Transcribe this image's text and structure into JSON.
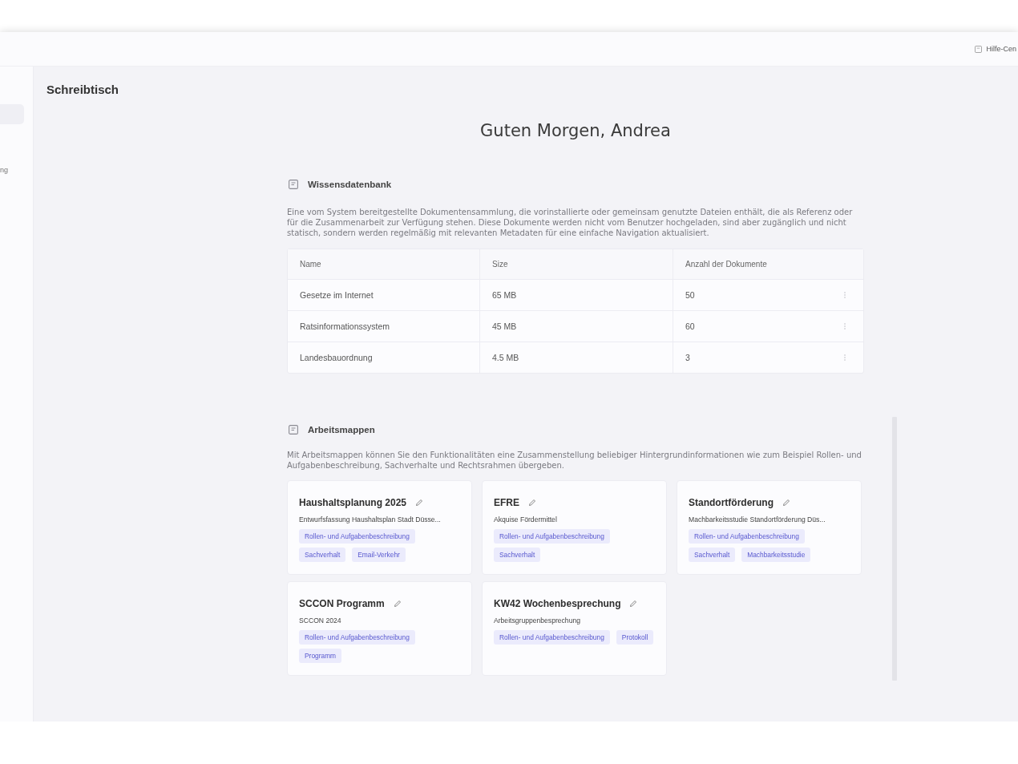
{
  "top_bar": {
    "help_link": "Hilfe-Cen"
  },
  "sidebar": {
    "items": [
      {
        "selected": true
      },
      {
        "label": "ng",
        "selected": false
      }
    ]
  },
  "page_title": "Schreibtisch",
  "greeting": "Guten Morgen, Andrea",
  "knowledge_base": {
    "title": "Wissensdatenbank",
    "description": "Eine vom System bereitgestellte Dokumentensammlung, die vorinstallierte oder gemeinsam genutzte Dateien enthält, die als Referenz oder für die Zusammenarbeit zur Verfügung stehen. Diese Dokumente werden nicht vom Benutzer hochgeladen, sind aber zugänglich und nicht statisch, sondern werden regelmäßig mit relevanten Metadaten für eine einfache Navigation aktualisiert.",
    "table": {
      "columns": [
        "Name",
        "Size",
        "Anzahl der Dokumente"
      ],
      "rows": [
        [
          "Gesetze im Internet",
          "65 MB",
          "50"
        ],
        [
          "Ratsinformationssystem",
          "45 MB",
          "60"
        ],
        [
          "Landesbauordnung",
          "4.5 MB",
          "3"
        ]
      ]
    }
  },
  "workbooks": {
    "title": "Arbeitsmappen",
    "description": "Mit Arbeitsmappen können Sie den Funktionalitäten eine Zusammenstellung beliebiger Hintergrundinformationen wie zum Beispiel Rollen- und Aufgabenbeschreibung, Sachverhalte und Rechtsrahmen übergeben.",
    "cards": [
      {
        "title": "Haushaltsplanung 2025",
        "subtitle": "Entwurfsfassung Haushaltsplan Stadt Düsse...",
        "tags": [
          "Rollen- und Aufgabenbeschreibung",
          "Sachverhalt",
          "Email-Verkehr"
        ]
      },
      {
        "title": "EFRE",
        "subtitle": "Akquise Fördermittel",
        "tags": [
          "Rollen- und Aufgabenbeschreibung",
          "Sachverhalt"
        ]
      },
      {
        "title": "Standortförderung",
        "subtitle": "Machbarkeitsstudie Standortförderung Düs...",
        "tags": [
          "Rollen- und Aufgabenbeschreibung",
          "Sachverhalt",
          "Machbarkeitsstudie"
        ]
      },
      {
        "title": "SCCON Programm",
        "subtitle": "SCCON 2024",
        "tags": [
          "Rollen- und Aufgabenbeschreibung",
          "Programm"
        ]
      },
      {
        "title": "KW42 Wochenbesprechung",
        "subtitle": "Arbeitsgruppenbesprechung",
        "tags": [
          "Rollen- und Aufgabenbeschreibung",
          "Protokoll"
        ]
      }
    ]
  }
}
